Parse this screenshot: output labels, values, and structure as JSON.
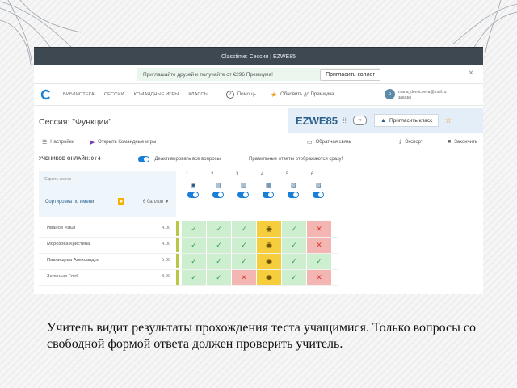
{
  "window": {
    "title": "Classtime: Сессия | EZWE85"
  },
  "promo": {
    "text": "Приглашайте друзей и получайте от €296 Премиума!",
    "button": "Пригласить коллег",
    "close": "×"
  },
  "nav": {
    "items": [
      "Библиотека",
      "Сессии",
      "Командные игры",
      "Классы"
    ],
    "help": "Помощь",
    "upgrade": "Обновить до Премиума",
    "avatar_letter": "e",
    "account": "maria_demicheva@mail.ru\nзаказы"
  },
  "session": {
    "title": "Сессия: \"Функции\"",
    "code": "EZWE85",
    "invite": "Пригласить класс"
  },
  "toolbar": {
    "settings": "Настройки",
    "closed_games": "Открыть Командные игры",
    "feedback": "Обратная связь",
    "export": "Экспорт",
    "finish": "Закончить"
  },
  "controls": {
    "online": "УЧЕНИКОВ ОНЛАЙН: 0 / 4",
    "deactivate": "Деактивировать все вопросы",
    "answers_note": "Правильные ответы отображаются сразу!"
  },
  "grid": {
    "hide_names": "Скрыть имена",
    "sort": "Сортировка по имени",
    "points": "6 баллов",
    "questions": [
      {
        "num": "1"
      },
      {
        "num": "2"
      },
      {
        "num": "3"
      },
      {
        "num": "4"
      },
      {
        "num": "5"
      },
      {
        "num": "6"
      }
    ],
    "students": [
      {
        "name": "Иванов Илья",
        "score": "4.00",
        "marks": [
          "ok",
          "ok",
          "ok",
          "eye",
          "ok",
          "x"
        ]
      },
      {
        "name": "Морозова Кристина",
        "score": "4.00",
        "marks": [
          "ok",
          "ok",
          "ok",
          "eye",
          "ok",
          "x"
        ]
      },
      {
        "name": "Павлищева Александра",
        "score": "5.00",
        "marks": [
          "ok",
          "ok",
          "ok",
          "eye",
          "ok",
          "ok"
        ]
      },
      {
        "name": "Зеленько Глеб",
        "score": "3.00",
        "marks": [
          "ok",
          "ok",
          "x",
          "eye",
          "ok",
          "x"
        ]
      }
    ]
  },
  "colors": {
    "ok": "#cdeecf",
    "eye": "#f6cd3c",
    "x": "#f4b6b2",
    "brand": "#1a7fd8",
    "bar": "#b7c942"
  },
  "caption": "Учитель видит результаты прохождения теста учащимися. Только вопросы со свободной формой ответа должен проверить учитель."
}
